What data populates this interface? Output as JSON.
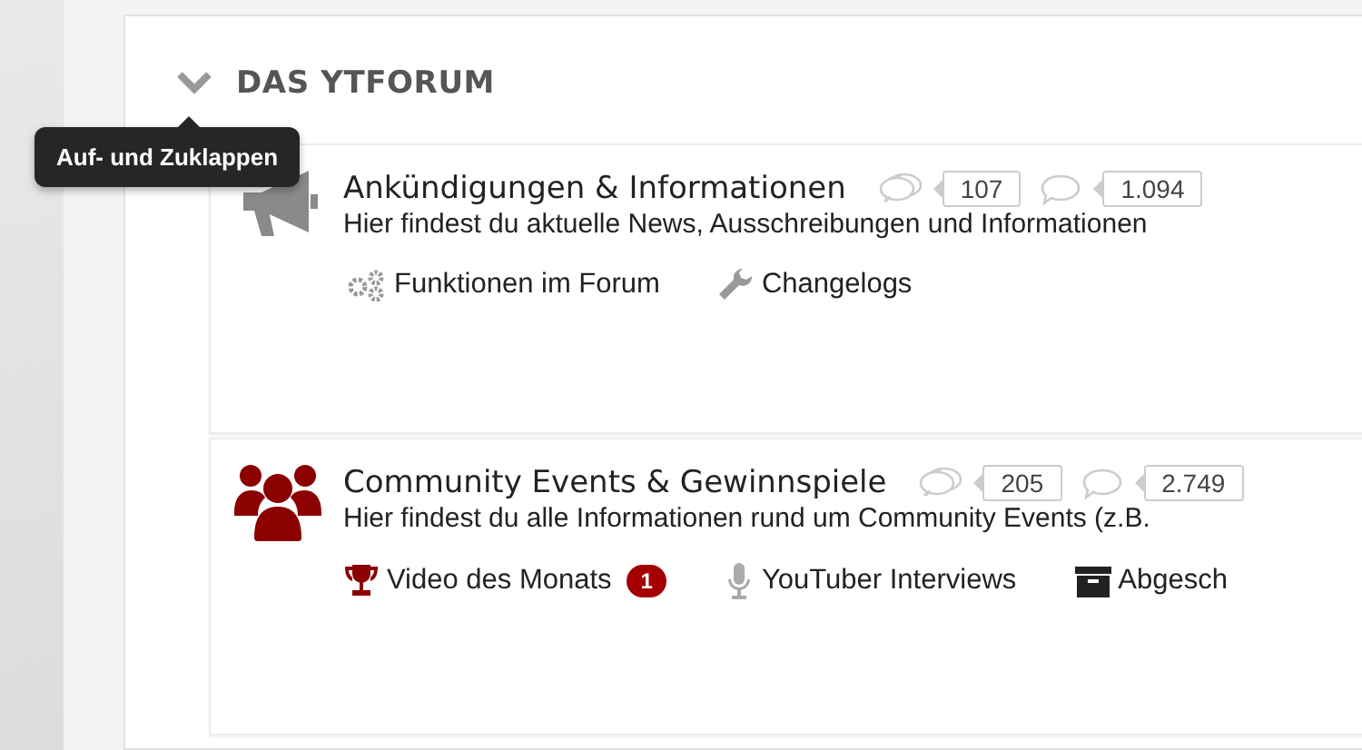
{
  "category": {
    "title": "DAS YTFORUM",
    "expanded": true,
    "tooltip": "Auf- und Zuklappen"
  },
  "forums": [
    {
      "kind": "announcements",
      "title": "Ankündigungen & Informationen",
      "threads": "107",
      "posts": "1.094",
      "description": "Hier findest du aktuelle News, Ausschreibungen und Informationen",
      "subforums": [
        {
          "kind": "features",
          "label": "Funktionen im Forum"
        },
        {
          "kind": "changelog",
          "label": "Changelogs"
        }
      ]
    },
    {
      "kind": "community",
      "title": "Community Events & Gewinnspiele",
      "threads": "205",
      "posts": "2.749",
      "description": "Hier findest du alle Informationen rund um Community Events (z.B.",
      "subforums": [
        {
          "kind": "award",
          "label": "Video des Monats",
          "badge": "1"
        },
        {
          "kind": "interview",
          "label": "YouTuber Interviews"
        },
        {
          "kind": "archive",
          "label": "Abgesch"
        }
      ]
    }
  ]
}
